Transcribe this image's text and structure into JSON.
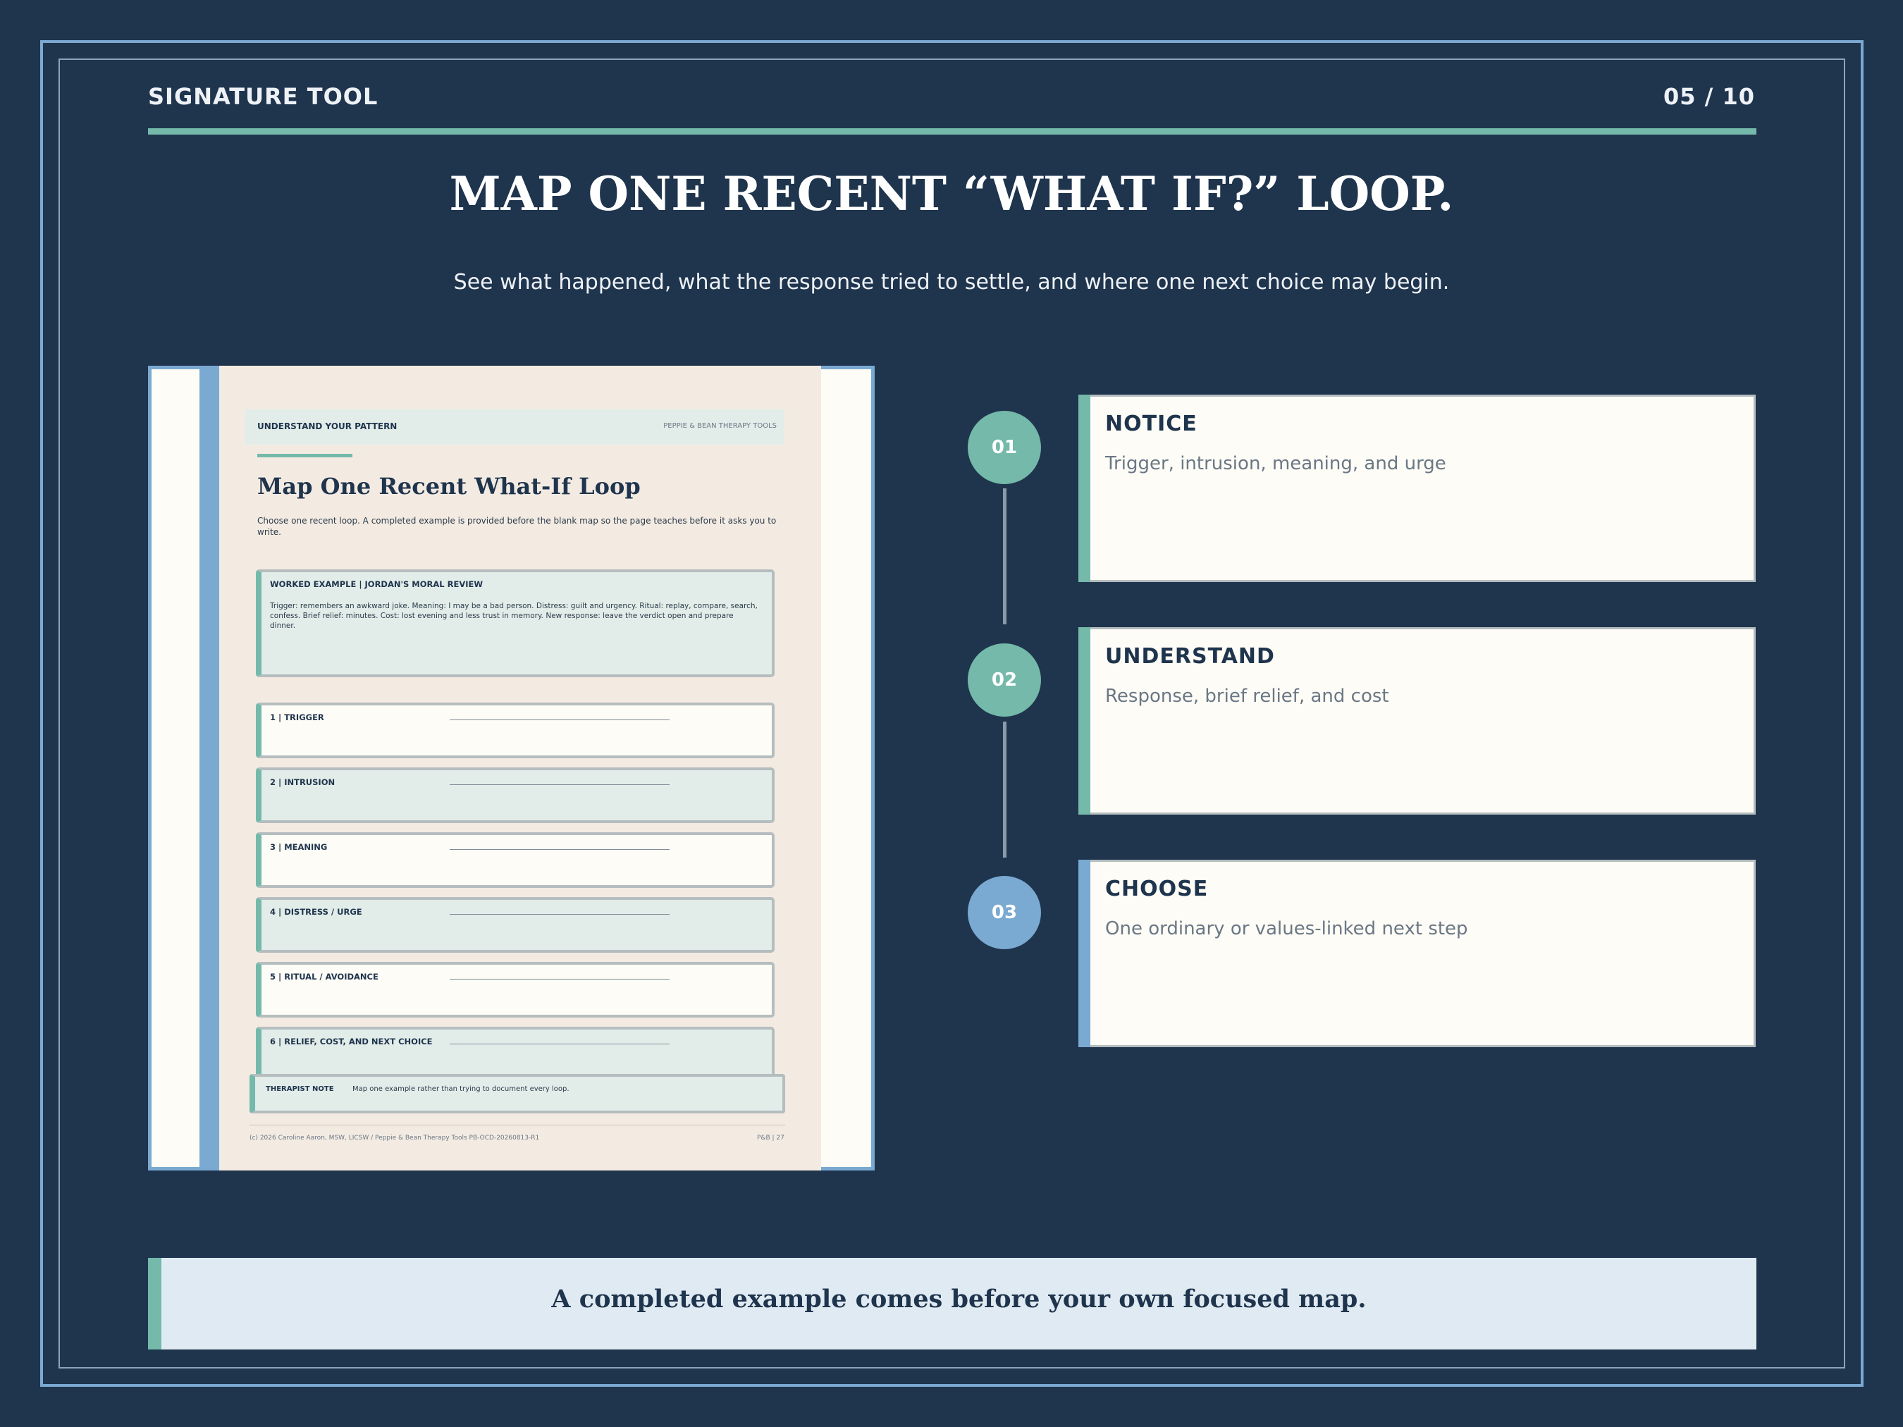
{
  "header": {
    "section_label": "SIGNATURE TOOL",
    "page_counter": "05 / 10"
  },
  "title": "MAP ONE RECENT “WHAT IF?” LOOP.",
  "subtitle": "See what happened, what the response tried to settle, and where one next choice may begin.",
  "worksheet": {
    "header_left": "UNDERSTAND YOUR PATTERN",
    "header_right": "PEPPIE & BEAN THERAPY TOOLS",
    "title": "Map One Recent What-If Loop",
    "intro": "Choose one recent loop. A completed example is provided before the blank map so the page teaches before it asks you to write.",
    "example": {
      "heading": "WORKED EXAMPLE | JORDAN'S MORAL REVIEW",
      "body": "Trigger: remembers an awkward joke. Meaning: I may be a bad person. Distress: guilt and urgency. Ritual: replay, compare, search, confess. Brief relief: minutes. Cost: lost evening and less trust in memory. New response: leave the verdict open and prepare dinner."
    },
    "fields": [
      {
        "label": "1 | TRIGGER"
      },
      {
        "label": "2 | INTRUSION"
      },
      {
        "label": "3 | MEANING"
      },
      {
        "label": "4 | DISTRESS / URGE"
      },
      {
        "label": "5 | RITUAL / AVOIDANCE"
      },
      {
        "label": "6 | RELIEF, COST, AND NEXT CHOICE"
      }
    ],
    "therapist_note": {
      "label": "THERAPIST NOTE",
      "text": "Map one example rather than trying to document every loop."
    },
    "footer_left": "(c) 2026 Caroline Aaron, MSW, LICSW / Peppie & Bean Therapy Tools    PB-OCD-20260813-R1",
    "footer_right": "P&B | 27"
  },
  "steps": [
    {
      "number": "01",
      "heading": "NOTICE",
      "description": "Trigger, intrusion, meaning, and urge",
      "color": "#74b9aa"
    },
    {
      "number": "02",
      "heading": "UNDERSTAND",
      "description": "Response, brief relief, and cost",
      "color": "#74b9aa"
    },
    {
      "number": "03",
      "heading": "CHOOSE",
      "description": "One ordinary or values-linked next step",
      "color": "#7aa9d1"
    }
  ],
  "callout": "A completed example comes before your own focused map.",
  "colors": {
    "background": "#1f344d",
    "accent_mint": "#74b9aa",
    "accent_blue": "#7aa9d1",
    "card": "#fdfcf6"
  }
}
